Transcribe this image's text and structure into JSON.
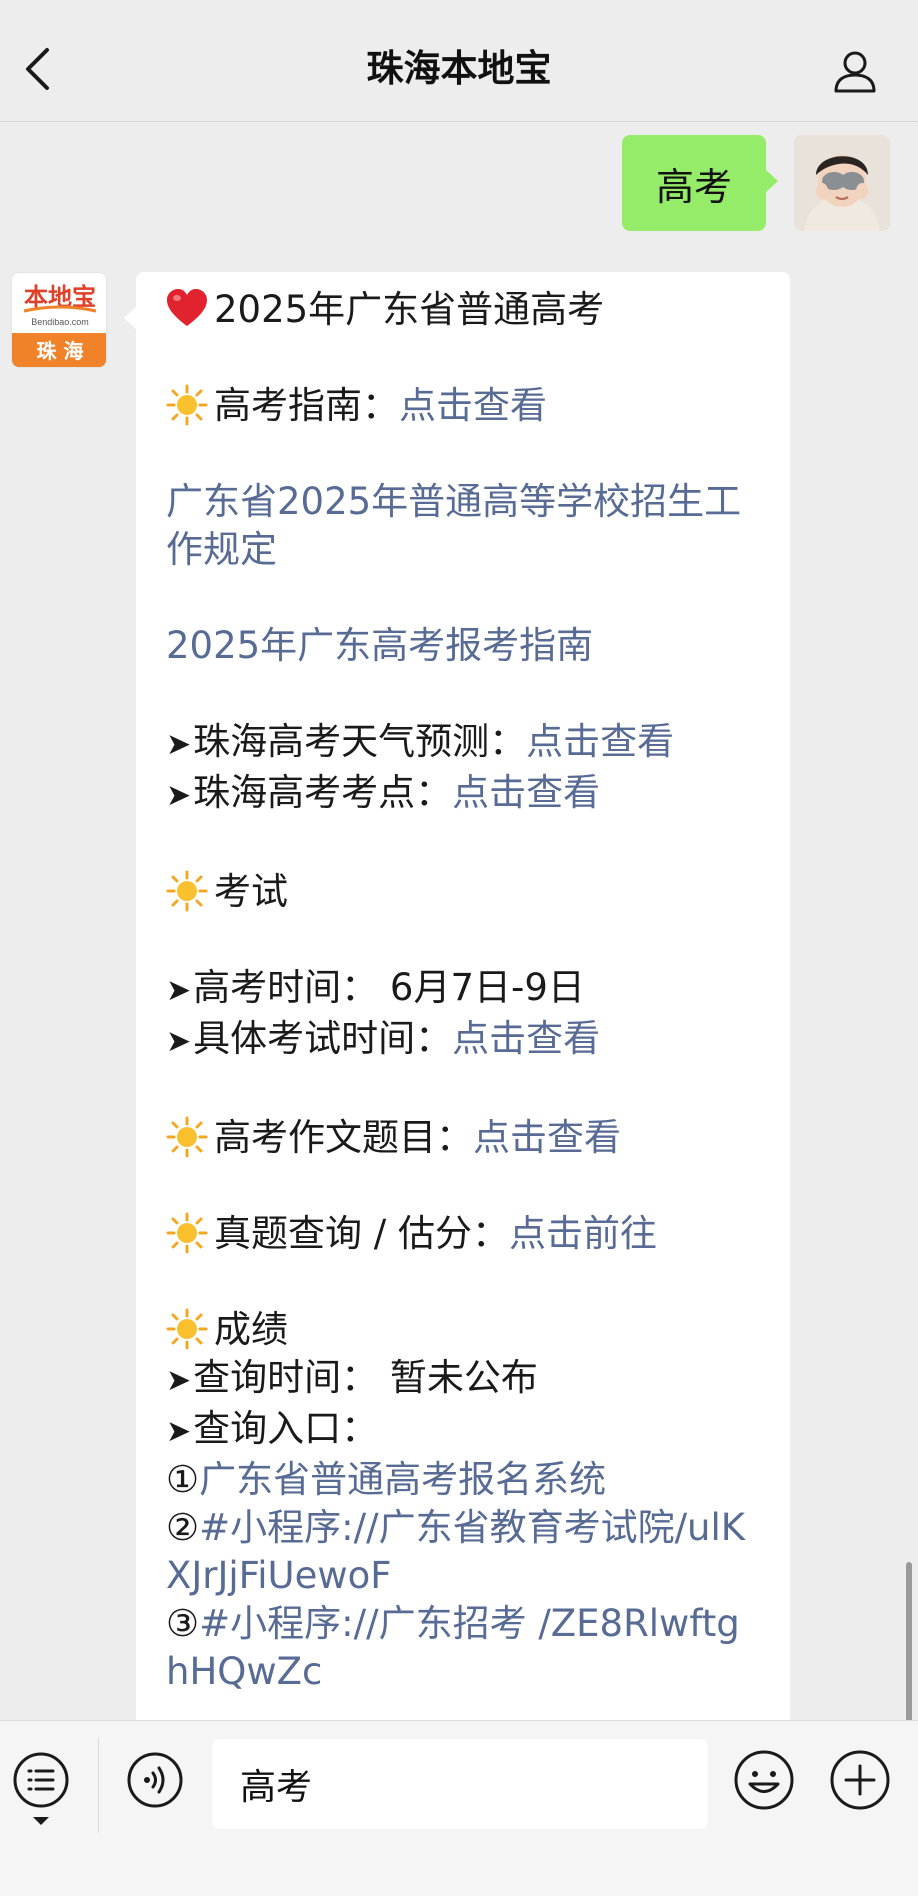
{
  "nav": {
    "title": "珠海本地宝"
  },
  "sent": {
    "text": "高考"
  },
  "bot": {
    "logo_top": "本地宝",
    "logo_sub": "Bendibao.com",
    "logo_city": "珠 海"
  },
  "message": {
    "title": "2025年广东省普通高考",
    "guide_label": "高考指南：",
    "guide_link": "点击查看",
    "rules_link": "广东省2025年普通高等学校招生工作规定",
    "apply_link": "2025年广东高考报考指南",
    "weather_label": "珠海高考天气预测：",
    "weather_link": "点击查看",
    "site_label": "珠海高考考点：",
    "site_link": "点击查看",
    "exam_heading": "考试",
    "time_label": "高考时间：  6月7日-9日",
    "detail_label": "具体考试时间：",
    "detail_link": "点击查看",
    "essay_label": "高考作文题目：",
    "essay_link": "点击查看",
    "query_label": "真题查询 / 估分：",
    "query_link": "点击前往",
    "score_heading": "成绩",
    "score_time": "查询时间：  暂未公布",
    "score_entry": "查询入口：",
    "entry1_num": "①",
    "entry1_link": "广东省普通高考报名系统",
    "entry2_num": "②",
    "entry2_link": "#小程序://广东省教育考试院/ulKXJrJjFiUewoF",
    "entry3_num": "③",
    "entry3_link": "#小程序://广东招考 /ZE8RlwftghHQwZc"
  },
  "input": {
    "value": "高考"
  },
  "icons": {
    "back": "back-chevron-icon",
    "profile": "person-icon",
    "menu": "menu-list-icon",
    "voice": "voice-icon",
    "emoji": "emoji-face-icon",
    "plus": "plus-circle-icon",
    "heart": "heart-icon",
    "sun": "sun-icon"
  },
  "colors": {
    "link": "#576b95",
    "sent_bubble": "#95ec69",
    "logo_orange": "#f0822a"
  }
}
